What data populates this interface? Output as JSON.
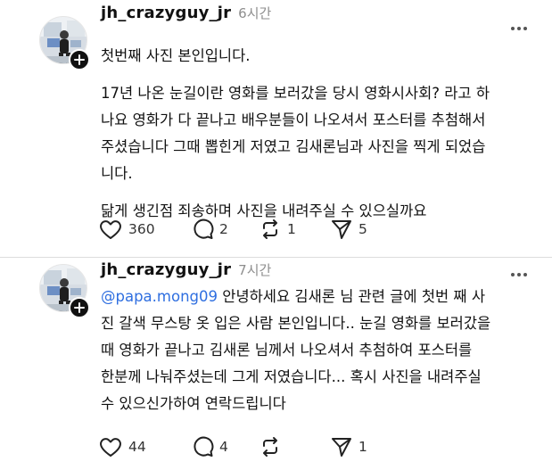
{
  "posts": [
    {
      "username": "jh_crazyguy_jr",
      "timestamp": "6시간",
      "paragraphs": [
        [
          "첫번째 사진 본인입니다."
        ],
        [
          "17년 나온 눈길이란 영화를 보러갔을 당시 영화시사회? 라고 하",
          "나요 영화가 다 끝나고 배우분들이 나오셔서 포스터를 추첨해서",
          "주셨습니다 그때 뽑힌게 저였고 김새론님과 사진을 찍게 되었습",
          "니다."
        ],
        [
          "닮게 생긴점 죄송하며 사진을 내려주실 수 있으실까요"
        ]
      ],
      "actions": {
        "likes": "360",
        "replies": "2",
        "reposts": "1",
        "shares": "5"
      }
    },
    {
      "username": "jh_crazyguy_jr",
      "timestamp": "7시간",
      "mention": "@papa.mong09",
      "lines": [
        " 안녕하세요 김새론 님 관련 글에 첫번 째 사",
        "진 갈색 무스탕 옷 입은 사람 본인입니다.. 눈길 영화를 보러갔을",
        "때 영화가 끝나고 김새론 님께서 나오셔서 추첨하여 포스터를",
        "한분께 나눠주셨는데 그게 저였습니다... 혹시 사진을 내려주실",
        "수 있으신가하여 연락드립니다"
      ],
      "actions": {
        "likes": "44",
        "replies": "4",
        "reposts": "",
        "shares": "1"
      }
    }
  ],
  "icons": [
    "avatar",
    "follow-plus-icon",
    "more-options-icon",
    "heart-icon",
    "comment-icon",
    "repost-icon",
    "share-icon"
  ],
  "colors": {
    "text": "#111111",
    "muted": "#8e8e8e",
    "mention": "#2f6fe0",
    "divider": "#dcdcdc"
  }
}
